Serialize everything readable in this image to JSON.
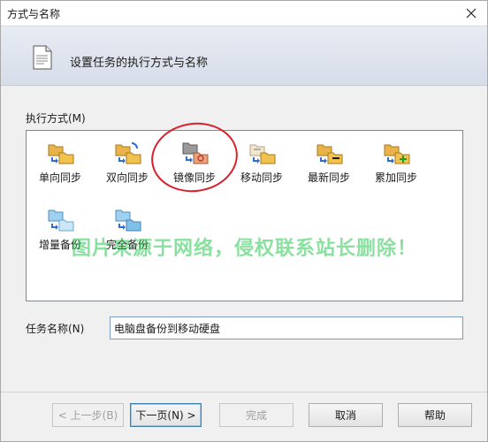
{
  "window": {
    "title": "方式与名称"
  },
  "header": {
    "title": "设置任务的执行方式与名称"
  },
  "method_section": {
    "label": "执行方式(M)"
  },
  "methods": [
    {
      "label": "单向同步",
      "icon": "one-way-sync-icon"
    },
    {
      "label": "双向同步",
      "icon": "two-way-sync-icon"
    },
    {
      "label": "镜像同步",
      "icon": "mirror-sync-icon"
    },
    {
      "label": "移动同步",
      "icon": "move-sync-icon"
    },
    {
      "label": "最新同步",
      "icon": "newest-sync-icon"
    },
    {
      "label": "累加同步",
      "icon": "cumulative-sync-icon"
    },
    {
      "label": "增量备份",
      "icon": "incremental-backup-icon"
    },
    {
      "label": "完全备份",
      "icon": "full-backup-icon"
    }
  ],
  "task_name": {
    "label": "任务名称(N)",
    "value": "电脑盘备份到移动硬盘"
  },
  "watermark": "图片来源于网络，侵权联系站长删除！",
  "buttons": {
    "back": "< 上一步(B)",
    "next": "下一页(N) >",
    "finish": "完成",
    "cancel": "取消",
    "help": "帮助"
  },
  "colors": {
    "annotation_circle": "#d8212b",
    "watermark": "#28c850",
    "header_bg": "#dfe4ee"
  }
}
